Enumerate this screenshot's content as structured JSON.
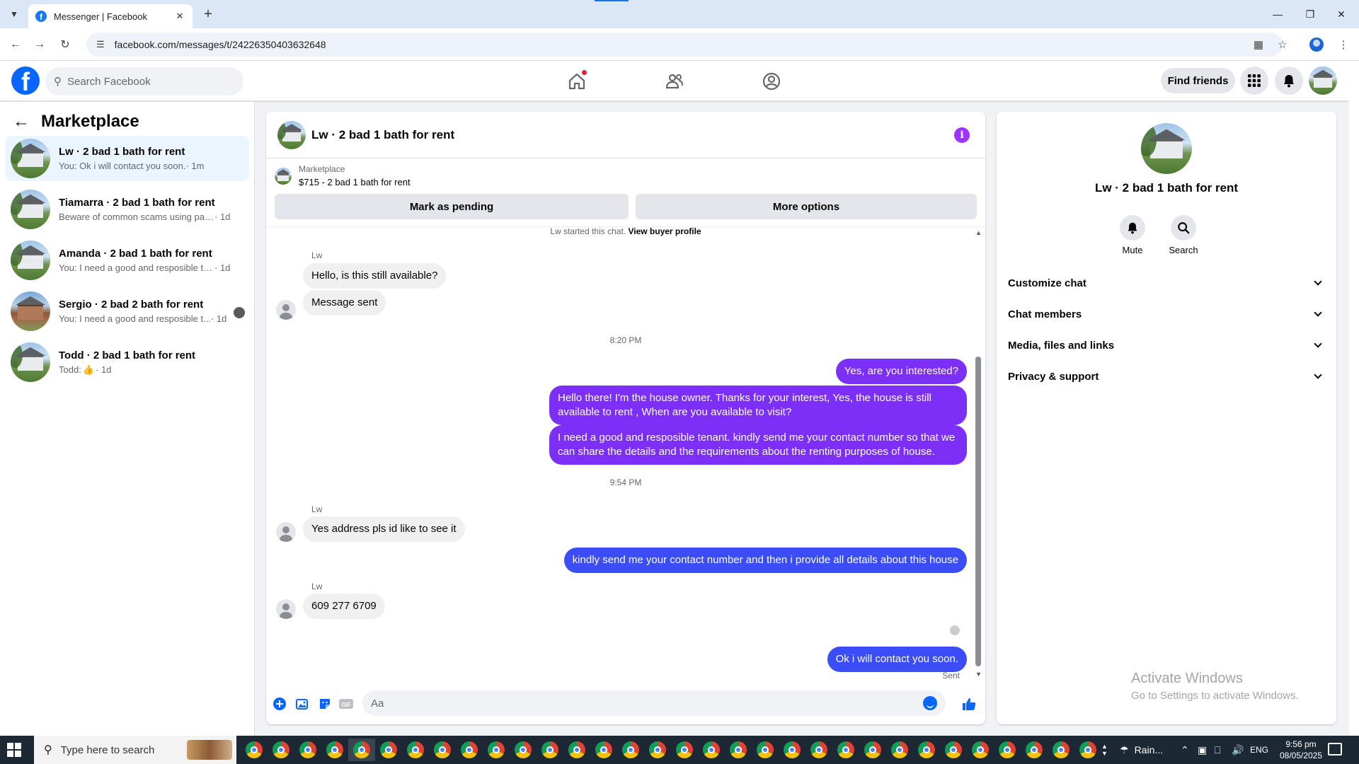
{
  "browser": {
    "tab_title": "Messenger | Facebook",
    "url": "facebook.com/messages/t/24226350403632648"
  },
  "header": {
    "logo_letter": "f",
    "search_placeholder": "Search Facebook",
    "find_friends": "Find friends"
  },
  "sidebar": {
    "title": "Marketplace",
    "conversations": [
      {
        "title": "Lw · 2 bad 1 bath for rent",
        "snippet": "You: Ok i will contact you soon.",
        "time": " · 1m",
        "active": true
      },
      {
        "title": "Tiamarra · 2 bad 1 bath for rent",
        "snippet": "Beware of common scams using pay...",
        "time": " · 1d"
      },
      {
        "title": "Amanda · 2 bad 1 bath for rent",
        "snippet": "You: I need a good and resposible ten...",
        "time": " · 1d"
      },
      {
        "title": "Sergio · 2 bad 2 bath for rent",
        "snippet": "You: I need a good and resposible t...",
        "time": " · 1d"
      },
      {
        "title": "Todd · 2 bad 1 bath for rent",
        "snippet": "Todd: ",
        "time": " · 1d"
      }
    ]
  },
  "chat": {
    "title": "Lw · 2 bad 1 bath for rent",
    "listing_label": "Marketplace",
    "listing_detail": "$715 - 2 bad 1 bath for rent",
    "mark_pending": "Mark as pending",
    "more_options": "More options",
    "system_note": "Lw started this chat. ",
    "system_link": "View buyer profile",
    "sender_name": "Lw",
    "messages": {
      "m1": "Hello, is this still available?",
      "m2": "Message sent",
      "t1": "8:20 PM",
      "m3": "Yes, are you interested?",
      "m4": "Hello there! I'm the house owner. Thanks for your interest, Yes, the house is still available to rent , When are you available to visit?",
      "m5": "I need a good and resposible tenant.  kindly send me your contact number so that we can share the details and the requirements about the renting purposes of house.",
      "t2": "9:54 PM",
      "m6": "Yes address pls id like to see it",
      "m7": "kindly send me your contact number and then i provide all details about this house",
      "m8": "609 277 6709",
      "m9": "Ok i will contact you soon."
    },
    "sent_status": "Sent",
    "composer_placeholder": "Aa"
  },
  "info_panel": {
    "name": "Lw · 2 bad 1 bath for rent",
    "mute": "Mute",
    "search": "Search",
    "sections": [
      "Customize chat",
      "Chat members",
      "Media, files and links",
      "Privacy & support"
    ]
  },
  "watermark": {
    "line1": "Activate Windows",
    "line2": "Go to Settings to activate Windows."
  },
  "taskbar": {
    "search_text": "Type here to search",
    "weather": "Rain...",
    "lang": "ENG",
    "time": "9:56 pm",
    "date": "08/05/2025"
  },
  "colors": {
    "fb_blue": "#0866ff",
    "outgoing_purple": "#7b2ff7",
    "outgoing_blue": "#3b4df7",
    "info_purple": "#a033ff"
  }
}
